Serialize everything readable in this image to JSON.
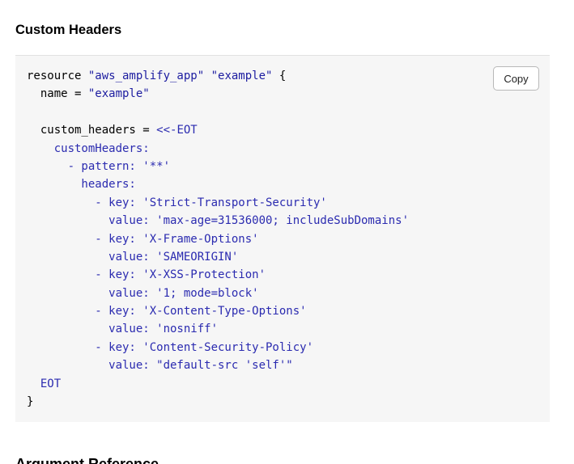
{
  "section": {
    "title": "Custom Headers"
  },
  "code_block": {
    "copy_label": "Copy",
    "lines": [
      [
        {
          "t": "resource ",
          "k": "p"
        },
        {
          "t": "\"aws_amplify_app\"",
          "k": "s"
        },
        {
          "t": " ",
          "k": "p"
        },
        {
          "t": "\"example\"",
          "k": "s"
        },
        {
          "t": " {",
          "k": "p"
        }
      ],
      [
        {
          "t": "  name = ",
          "k": "p"
        },
        {
          "t": "\"example\"",
          "k": "s"
        }
      ],
      [
        {
          "t": "",
          "k": "p"
        }
      ],
      [
        {
          "t": "  custom_headers = ",
          "k": "p"
        },
        {
          "t": "<<-EOT",
          "k": "h"
        }
      ],
      [
        {
          "t": "    customHeaders:",
          "k": "h"
        }
      ],
      [
        {
          "t": "      - pattern: '**'",
          "k": "h"
        }
      ],
      [
        {
          "t": "        headers:",
          "k": "h"
        }
      ],
      [
        {
          "t": "          - key: 'Strict-Transport-Security'",
          "k": "h"
        }
      ],
      [
        {
          "t": "            value: 'max-age=31536000; includeSubDomains'",
          "k": "h"
        }
      ],
      [
        {
          "t": "          - key: 'X-Frame-Options'",
          "k": "h"
        }
      ],
      [
        {
          "t": "            value: 'SAMEORIGIN'",
          "k": "h"
        }
      ],
      [
        {
          "t": "          - key: 'X-XSS-Protection'",
          "k": "h"
        }
      ],
      [
        {
          "t": "            value: '1; mode=block'",
          "k": "h"
        }
      ],
      [
        {
          "t": "          - key: 'X-Content-Type-Options'",
          "k": "h"
        }
      ],
      [
        {
          "t": "            value: 'nosniff'",
          "k": "h"
        }
      ],
      [
        {
          "t": "          - key: 'Content-Security-Policy'",
          "k": "h"
        }
      ],
      [
        {
          "t": "            value: \"default-src 'self'\"",
          "k": "h"
        }
      ],
      [
        {
          "t": "  EOT",
          "k": "h"
        }
      ],
      [
        {
          "t": "}",
          "k": "p"
        }
      ]
    ]
  },
  "next_section": {
    "title": "Argument Reference"
  }
}
